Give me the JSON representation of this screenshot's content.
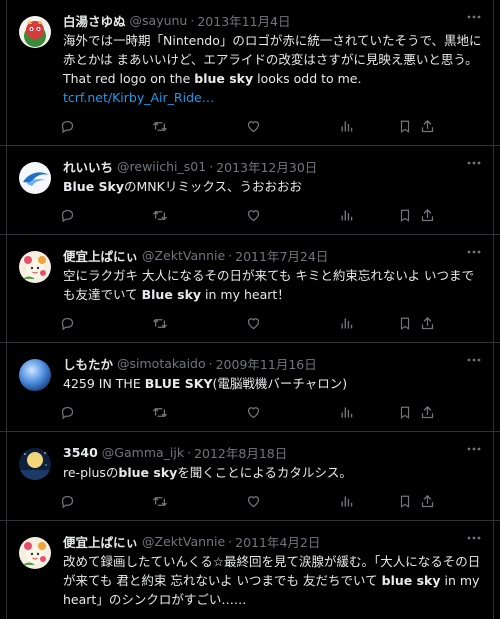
{
  "tweets": [
    {
      "name": "白湯さゆぬ",
      "handle": "@sayunu",
      "sep": "·",
      "date": "2013年11月4日",
      "avatar": "red-character-avatar",
      "parts": [
        {
          "t": "海外では一時期「Nintendo」のロゴが赤に統一されていたそうで、黒地に赤とかは まあいいけど、エアライドの改変はさすがに見映え悪いと思う。That red logo on the "
        },
        {
          "t": "blue sky",
          "b": true
        },
        {
          "t": " looks odd to me."
        }
      ],
      "link": "tcrf.net/Kirby_Air_Ride…"
    },
    {
      "name": "れいいち",
      "handle": "@rewiichi_s01",
      "sep": "·",
      "date": "2013年12月30日",
      "avatar": "white-blue-swoosh-avatar",
      "parts": [
        {
          "t": "Blue Sky",
          "b": true
        },
        {
          "t": "のMNKリミックス、うおおおお"
        }
      ]
    },
    {
      "name": "便宜上ぱにぃ",
      "handle": "@ZektVannie",
      "sep": "·",
      "date": "2011年7月24日",
      "avatar": "flower-character-avatar",
      "parts": [
        {
          "t": "空にラクガキ 大人になるその日が来ても キミと約束忘れないよ いつまでも友達でいて "
        },
        {
          "t": "Blue sky",
          "b": true
        },
        {
          "t": " in my heart！"
        }
      ]
    },
    {
      "name": "しもたか",
      "handle": "@simotakaido",
      "sep": "·",
      "date": "2009年11月16日",
      "avatar": "blue-sphere-avatar",
      "parts": [
        {
          "t": "4259 IN THE "
        },
        {
          "t": "BLUE SKY",
          "b": true
        },
        {
          "t": "(電脳戦機バーチャロン)"
        }
      ]
    },
    {
      "name": "3540",
      "handle": "@Gamma_ijk",
      "sep": "·",
      "date": "2012年8月18日",
      "avatar": "night-sky-avatar",
      "parts": [
        {
          "t": "re-plusの"
        },
        {
          "t": "blue sky",
          "b": true
        },
        {
          "t": "を聞くことによるカタルシス。"
        }
      ]
    },
    {
      "name": "便宜上ぱにぃ",
      "handle": "@ZektVannie",
      "sep": "·",
      "date": "2011年4月2日",
      "avatar": "flower-character-avatar",
      "parts": [
        {
          "t": "改めて録画したていんくる☆最終回を見て涙腺が緩む。「大人になるその日が来ても 君と約束 忘れないよ いつまでも 友だちでいて "
        },
        {
          "t": "blue sky",
          "b": true
        },
        {
          "t": " in my heart」のシンクロがすごい……"
        }
      ]
    }
  ]
}
